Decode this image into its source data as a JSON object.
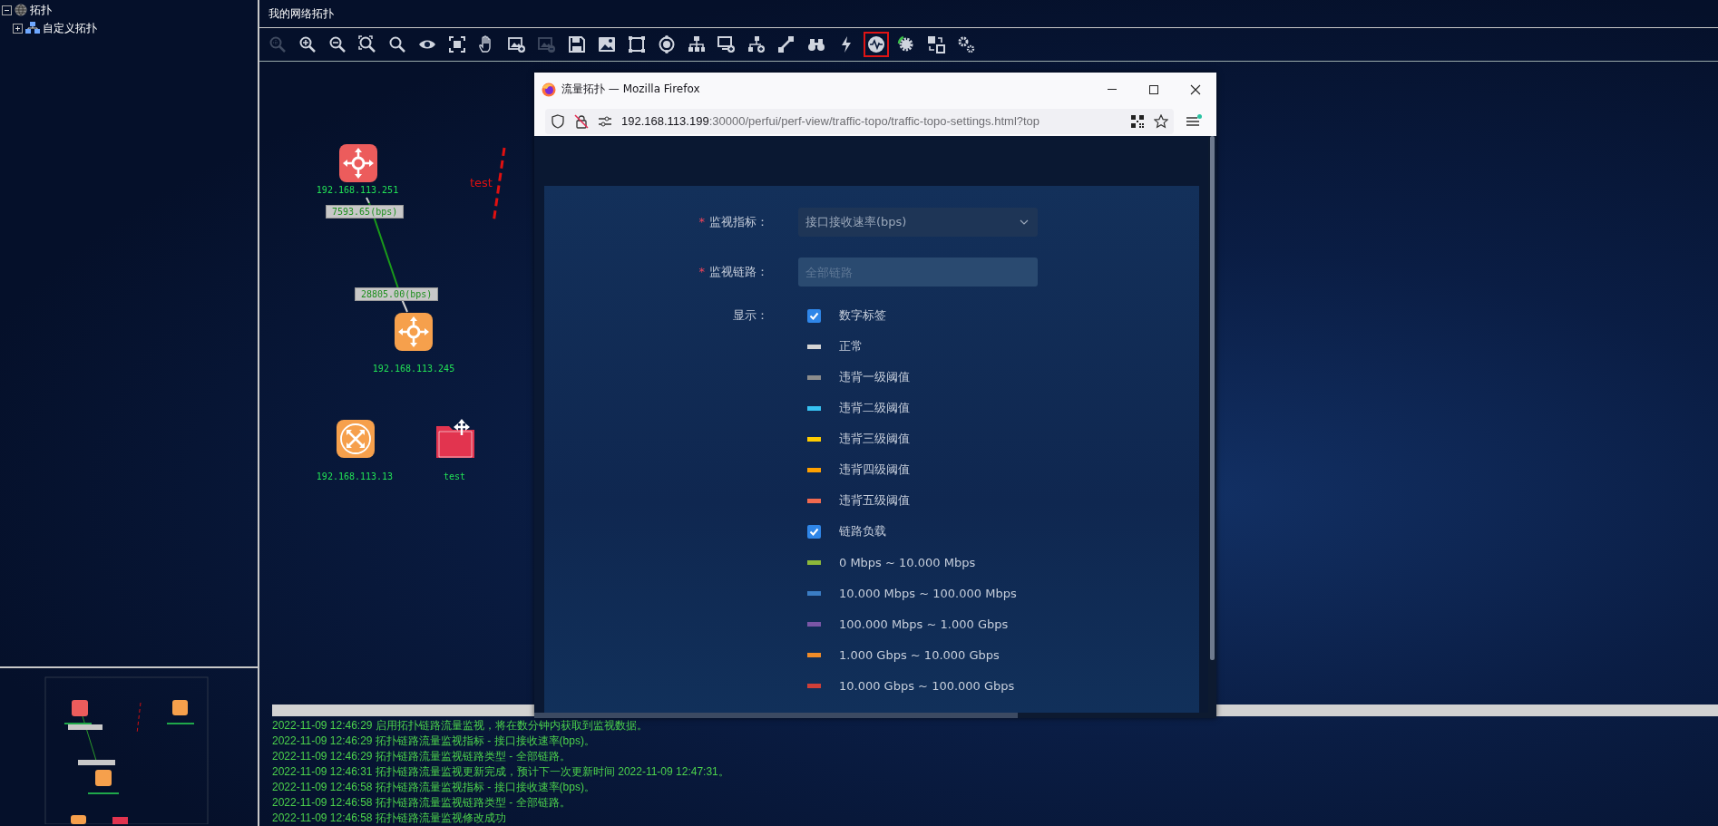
{
  "sidebar": {
    "tree": [
      {
        "label": "拓扑",
        "expanded": true,
        "children": [
          {
            "label": "自定义拓扑",
            "expanded": false
          }
        ]
      }
    ]
  },
  "main": {
    "title": "我的网络拓扑"
  },
  "toolbar": [
    {
      "disabled": true,
      "selected": false
    },
    {
      "disabled": false,
      "selected": false
    },
    {
      "disabled": false,
      "selected": false
    },
    {
      "disabled": false,
      "selected": false
    },
    {
      "disabled": false,
      "selected": false
    },
    {
      "disabled": false,
      "selected": false
    },
    {
      "disabled": false,
      "selected": false
    },
    {
      "disabled": false,
      "selected": false
    },
    {
      "disabled": false,
      "selected": false
    },
    {
      "disabled": true,
      "selected": false
    },
    {
      "disabled": false,
      "selected": false
    },
    {
      "disabled": false,
      "selected": false
    },
    {
      "disabled": false,
      "selected": false
    },
    {
      "disabled": false,
      "selected": false
    },
    {
      "disabled": false,
      "selected": false
    },
    {
      "disabled": false,
      "selected": false
    },
    {
      "disabled": false,
      "selected": false
    },
    {
      "disabled": false,
      "selected": false
    },
    {
      "disabled": false,
      "selected": false
    },
    {
      "disabled": false,
      "selected": false
    },
    {
      "disabled": false,
      "selected": true
    },
    {
      "disabled": false,
      "selected": false
    },
    {
      "disabled": false,
      "selected": false
    },
    {
      "disabled": false,
      "selected": false
    }
  ],
  "topology": {
    "nodes": [
      {
        "kind": "router",
        "color": "#ec5c5c",
        "label": "192.168.113.251"
      },
      {
        "kind": "router",
        "color": "#f6a04c",
        "label": "192.168.113.245"
      },
      {
        "kind": "switch",
        "color": "#f6a04c",
        "label": "192.168.113.13"
      },
      {
        "kind": "folder",
        "color": "#e2344f",
        "label": "test"
      }
    ],
    "links": [
      {
        "labels": [
          "7593.65(bps)",
          "28805.00(bps)"
        ]
      }
    ],
    "annotation": {
      "text": "test"
    }
  },
  "browser_window": {
    "title": "流量拓扑 — Mozilla Firefox",
    "url_host": "192.168.113.199",
    "url_path": ":30000/perfui/perf-view/traffic-topo/traffic-topo-settings.html?top",
    "form": {
      "fields": [
        {
          "kind": "select",
          "marker": "*",
          "label": "监视指标：",
          "value": "接口接收速率(bps)"
        },
        {
          "kind": "input",
          "marker": "*",
          "label": "监视链路：",
          "placeholder": "全部链路"
        }
      ],
      "display_label": "显示：",
      "legend": [
        {
          "kind": "checkbox",
          "label": "数字标签",
          "checked": true
        },
        {
          "kind": "swatch",
          "label": "正常",
          "color": "#d4d4d4"
        },
        {
          "kind": "swatch",
          "label": "违背一级阈值",
          "color": "#8c8c8c"
        },
        {
          "kind": "swatch",
          "label": "违背二级阈值",
          "color": "#36c2f2"
        },
        {
          "kind": "swatch",
          "label": "违背三级阈值",
          "color": "#ffcc00"
        },
        {
          "kind": "swatch",
          "label": "违背四级阈值",
          "color": "#ffa000"
        },
        {
          "kind": "swatch",
          "label": "违背五级阈值",
          "color": "#f26a4f"
        },
        {
          "kind": "checkbox",
          "label": "链路负载",
          "checked": true
        },
        {
          "kind": "swatch",
          "label": "0 Mbps ~ 10.000 Mbps",
          "color": "#8db83a"
        },
        {
          "kind": "swatch",
          "label": "10.000 Mbps ~ 100.000 Mbps",
          "color": "#3b7dc4"
        },
        {
          "kind": "swatch",
          "label": "100.000 Mbps ~ 1.000 Gbps",
          "color": "#7a56a6"
        },
        {
          "kind": "swatch",
          "label": "1.000 Gbps ~ 10.000 Gbps",
          "color": "#f08c28"
        },
        {
          "kind": "swatch",
          "label": "10.000 Gbps ~ 100.000 Gbps",
          "color": "#cf3f38"
        }
      ]
    }
  },
  "log": [
    "2022-11-09 12:46:29 启用拓扑链路流量监视，将在数分钟内获取到监视数据。",
    "2022-11-09 12:46:29 拓扑链路流量监视指标 - 接口接收速率(bps)。",
    "2022-11-09 12:46:29 拓扑链路流量监视链路类型 - 全部链路。",
    "2022-11-09 12:46:31 拓扑链路流量监视更新完成，预计下一次更新时间 2022-11-09 12:47:31。",
    "2022-11-09 12:46:58 拓扑链路流量监视指标 - 接口接收速率(bps)。",
    "2022-11-09 12:46:58 拓扑链路流量监视链路类型 - 全部链路。",
    "2022-11-09 12:46:58 拓扑链路流量监视修改成功"
  ]
}
